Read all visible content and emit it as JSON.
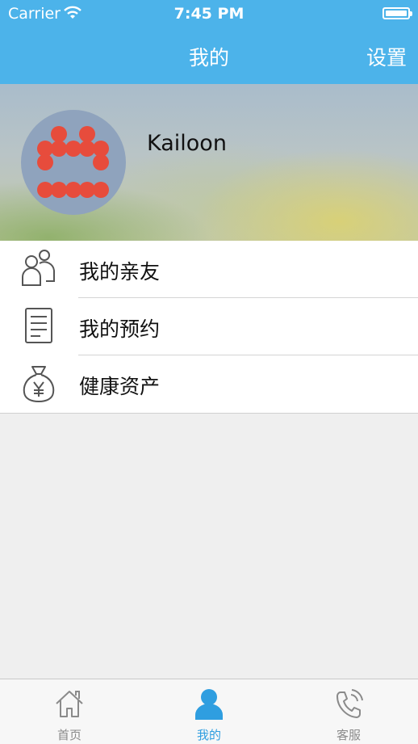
{
  "status_bar": {
    "carrier": "Carrier",
    "time": "7:45 PM"
  },
  "nav": {
    "title": "我的",
    "right_button": "设置"
  },
  "profile": {
    "username": "Kailoon"
  },
  "menu": {
    "items": [
      {
        "label": "我的亲友",
        "icon": "friends-icon"
      },
      {
        "label": "我的预约",
        "icon": "document-icon"
      },
      {
        "label": "健康资产",
        "icon": "money-bag-icon"
      }
    ]
  },
  "tabbar": {
    "tabs": [
      {
        "label": "首页",
        "icon": "home-icon"
      },
      {
        "label": "我的",
        "icon": "person-icon",
        "active": true
      },
      {
        "label": "客服",
        "icon": "phone-icon"
      }
    ]
  },
  "colors": {
    "brand_blue": "#4cb3ea",
    "active_tab": "#2f9ee0",
    "avatar_red": "#e74c3c"
  }
}
